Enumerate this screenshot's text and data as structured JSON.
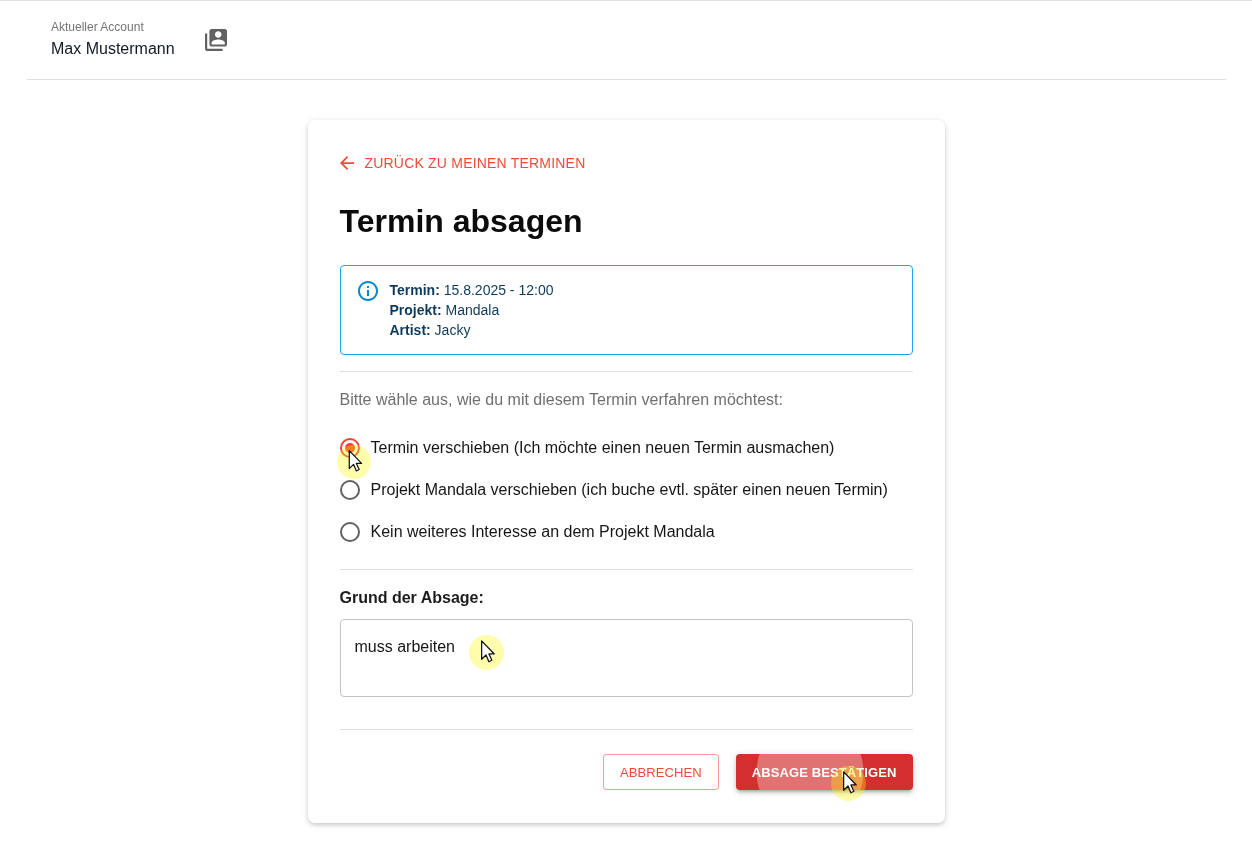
{
  "header": {
    "account_label": "Aktueller Account",
    "account_name": "Max Mustermann"
  },
  "card": {
    "back_link": "ZURÜCK ZU MEINEN TERMINEN",
    "title": "Termin absagen",
    "info": [
      "**Termin:** 15.8.2025 - 12:00",
      "**Projekt:** Mandala",
      "**Artist:** Jacky"
    ],
    "prompt": "Bitte wähle aus, wie du mit diesem Termin verfahren möchtest:",
    "options": [
      {
        "label": "Termin verschieben (Ich möchte einen neuen Termin ausmachen)",
        "selected": true
      },
      {
        "label": "Projekt Mandala verschieben (ich buche evtl. später einen neuen Termin)",
        "selected": false
      },
      {
        "label": "Kein weiteres Interesse an dem Projekt Mandala",
        "selected": false
      }
    ],
    "reason": {
      "label": "Grund der Absage:",
      "value": "muss arbeiten"
    },
    "buttons": [
      {
        "kind": "outlined",
        "label": "ABBRECHEN",
        "pressed": false
      },
      {
        "kind": "contained",
        "label": "ABSAGE BESTÄTIGEN",
        "pressed": true
      }
    ]
  }
}
